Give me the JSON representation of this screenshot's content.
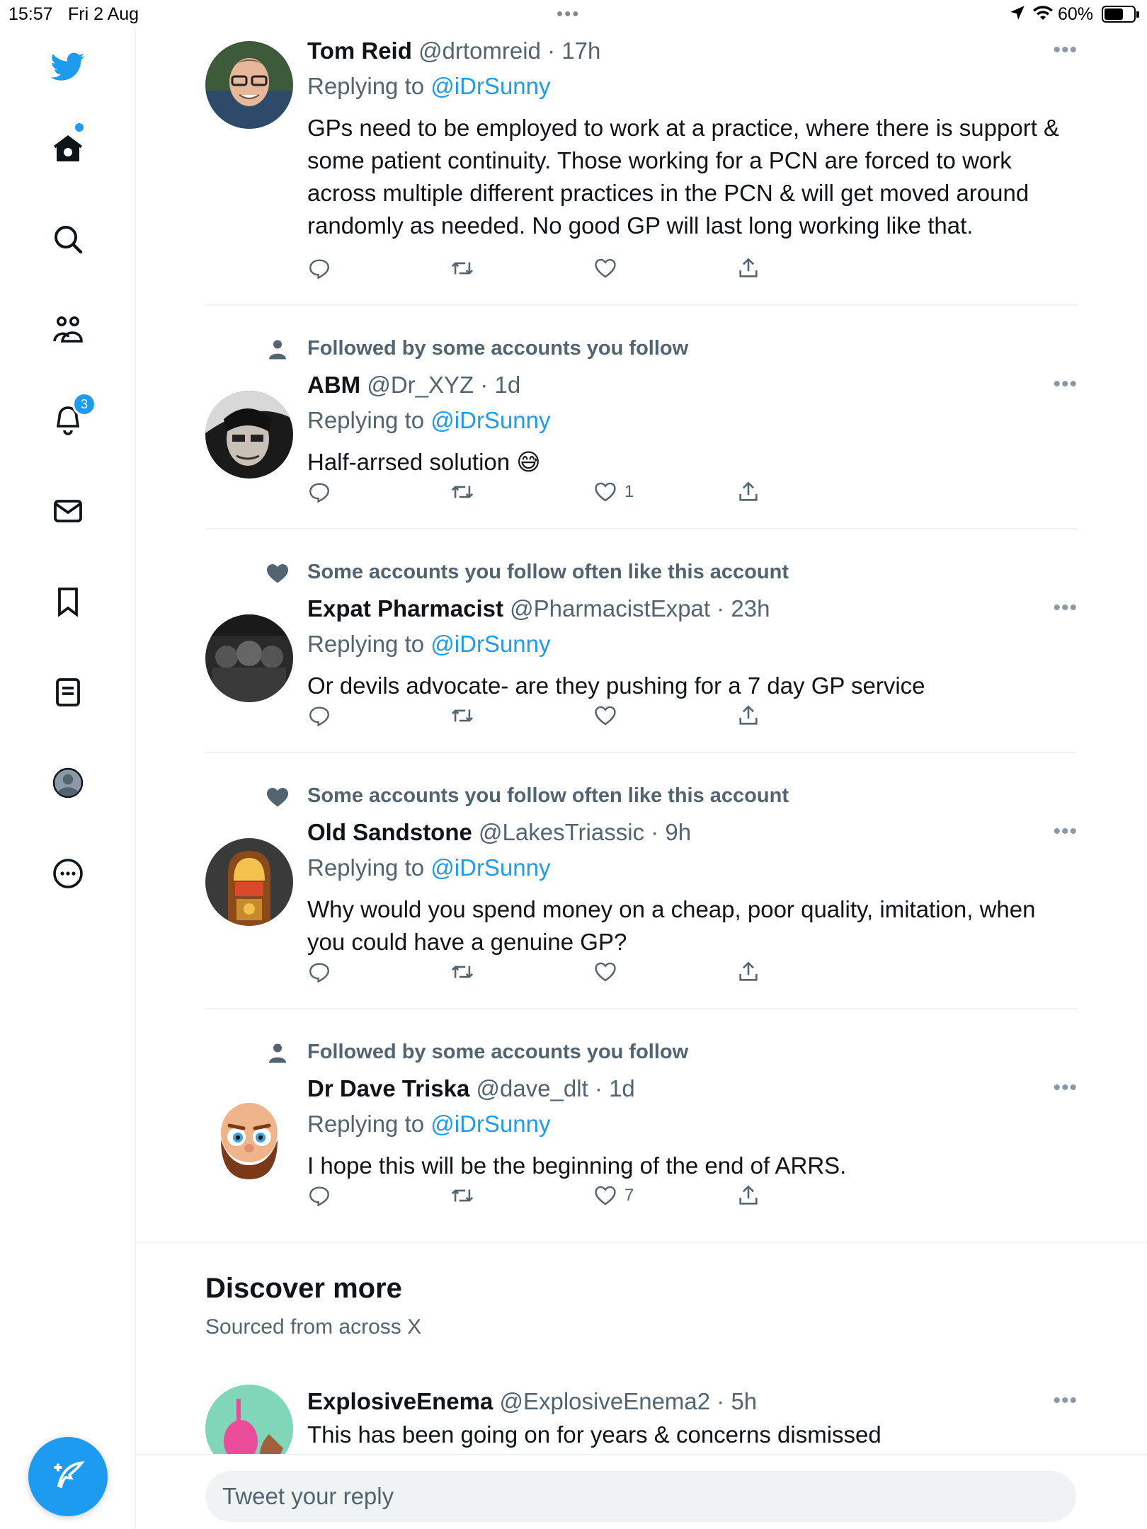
{
  "status_bar": {
    "time": "15:57",
    "date": "Fri 2 Aug",
    "battery": "60%"
  },
  "sidebar": {
    "items": [
      {
        "name": "twitter-logo-icon"
      },
      {
        "name": "home-icon"
      },
      {
        "name": "search-icon"
      },
      {
        "name": "communities-icon"
      },
      {
        "name": "notifications-icon",
        "badge": "3"
      },
      {
        "name": "messages-icon"
      },
      {
        "name": "bookmarks-icon"
      },
      {
        "name": "lists-icon"
      },
      {
        "name": "profile-icon"
      },
      {
        "name": "more-icon"
      }
    ],
    "compose_icon": "compose-icon"
  },
  "colors": {
    "accent": "#1d9bf0",
    "secondary_text": "#536471",
    "primary_text": "#0f1419"
  },
  "tweets": [
    {
      "name": "Tom Reid",
      "handle": "@drtomreid",
      "time": "· 17h",
      "replying_label": "Replying to",
      "replying_to": "@iDrSunny",
      "text": "GPs need to be employed to work at a practice, where there is support & some patient continuity. Those working for a PCN are forced to work across multiple different practices in the PCN & will get moved around randomly as needed. No good GP will last long working like that.",
      "likes": ""
    },
    {
      "social": "Followed by some accounts you follow",
      "social_icon": "person-icon",
      "name": "ABM",
      "handle": "@Dr_XYZ",
      "time": "· 1d",
      "replying_label": "Replying to",
      "replying_to": "@iDrSunny",
      "text": "Half-arrsed solution 😅",
      "likes": "1"
    },
    {
      "social": "Some accounts you follow often like this account",
      "social_icon": "heart-icon",
      "name": "Expat Pharmacist",
      "handle": "@PharmacistExpat",
      "time": "· 23h",
      "replying_label": "Replying to",
      "replying_to": "@iDrSunny",
      "text": "Or devils advocate- are they pushing for a 7 day GP service",
      "likes": ""
    },
    {
      "social": "Some accounts you follow often like this account",
      "social_icon": "heart-icon",
      "name": "Old Sandstone",
      "handle": "@LakesTriassic",
      "time": "· 9h",
      "replying_label": "Replying to",
      "replying_to": "@iDrSunny",
      "text": "Why would you spend money on a cheap, poor quality, imitation, when you could have a genuine GP?",
      "likes": ""
    },
    {
      "social": "Followed by some accounts you follow",
      "social_icon": "person-icon",
      "name": "Dr Dave Triska",
      "handle": "@dave_dlt",
      "time": "· 1d",
      "replying_label": "Replying to",
      "replying_to": "@iDrSunny",
      "text": "I hope this will be the beginning of the end of ARRS.",
      "likes": "7"
    }
  ],
  "discover": {
    "title": "Discover more",
    "subtitle": "Sourced from across X",
    "tweet": {
      "name": "ExplosiveEnema",
      "handle": "@ExplosiveEnema2",
      "time": "· 5h",
      "text": "This has been going on for years & concerns dismissed"
    }
  },
  "reply": {
    "placeholder": "Tweet your reply"
  }
}
